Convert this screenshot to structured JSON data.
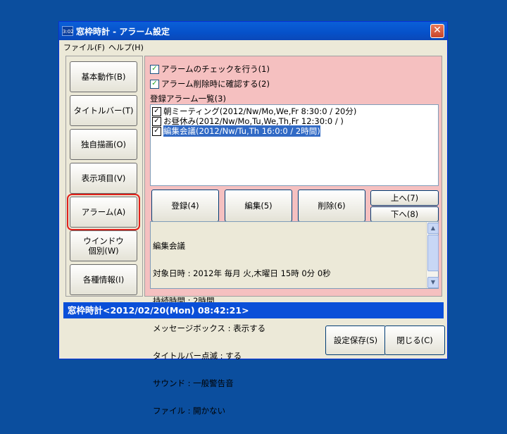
{
  "window": {
    "app_icon_text": "3:02",
    "title": "窓枠時計 - アラーム設定",
    "close_glyph": "✕"
  },
  "menu": [
    {
      "label": "ファイル(F)"
    },
    {
      "label": "ヘルプ(H)"
    }
  ],
  "sidebar": {
    "items": [
      {
        "label": "基本動作(B)"
      },
      {
        "label": "タイトルバー(T)"
      },
      {
        "label": "独自描画(O)"
      },
      {
        "label": "表示項目(V)"
      },
      {
        "label": "アラーム(A)",
        "selected": true
      },
      {
        "label_line1": "ウインドウ",
        "label_line2": "個別(W)"
      },
      {
        "label": "各種情報(I)"
      }
    ]
  },
  "options": {
    "check_alarm": {
      "label": "アラームのチェックを行う(1)",
      "checked": true
    },
    "confirm_delete": {
      "label": "アラーム削除時に確認する(2)",
      "checked": true
    }
  },
  "alarm_list": {
    "label": "登録アラーム一覧(3)",
    "items": [
      {
        "text": "朝ミーティング(2012/Nw/Mo,We,Fr 8:30:0 / 20分)",
        "checked": true,
        "selected": false
      },
      {
        "text": "お昼休み(2012/Nw/Mo,Tu,We,Th,Fr 12:30:0 / )",
        "checked": true,
        "selected": false
      },
      {
        "text": "編集会議(2012/Nw/Tu,Th 16:0:0 / 2時間)",
        "checked": true,
        "selected": true
      }
    ]
  },
  "actions": {
    "register": "登録(4)",
    "edit": "編集(5)",
    "delete": "削除(6)",
    "up": "上へ(7)",
    "down": "下へ(8)"
  },
  "detail": {
    "lines": [
      "編集会議",
      "対象日時 : 2012年 毎月 火,木曜日 15時 0分 0秒",
      "持続時間 : 2時間",
      "メッセージボックス : 表示する",
      "タイトルバー点滅 : する",
      "サウンド : 一般警告音",
      "ファイル : 開かない"
    ]
  },
  "status": {
    "text": "窓枠時計<2012/02/20(Mon) 08:42:21>"
  },
  "footer": {
    "save": "設定保存(S)",
    "close": "閉じる(C)"
  },
  "colors": {
    "desktop": "#0b4e9e",
    "panel_background": "#f5c0c0",
    "selection": "#316ac5",
    "status_bar": "#0a4fd8",
    "highlight_border": "#e0201a"
  }
}
